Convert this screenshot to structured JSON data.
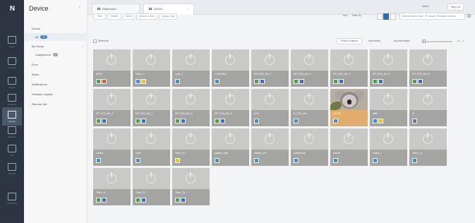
{
  "rail": {
    "logo": "N",
    "items": [
      {
        "name": "home",
        "label": "Home"
      },
      {
        "name": "content",
        "label": "Content"
      },
      {
        "name": "playlist",
        "label": "Playlist"
      },
      {
        "name": "schedule",
        "label": "Schedule"
      },
      {
        "name": "device",
        "label": "Device"
      },
      {
        "name": "statistics",
        "label": "Statistics"
      },
      {
        "name": "user",
        "label": "User"
      },
      {
        "name": "settings",
        "label": "Settings"
      },
      {
        "name": "information",
        "label": "Information"
      }
    ]
  },
  "nav": {
    "title": "Device",
    "items": [
      {
        "label": "Device",
        "badge": ""
      },
      {
        "label": "All",
        "badge": "33"
      },
      {
        "label": "By Group",
        "badge": ""
      },
      {
        "label": "Unapproved",
        "badge": "0"
      },
      {
        "label": "Error",
        "badge": ""
      },
      {
        "label": "Alarm",
        "badge": ""
      },
      {
        "label": "Notifications",
        "badge": ""
      },
      {
        "label": "Software Update",
        "badge": ""
      },
      {
        "label": "Remote Job",
        "badge": ""
      }
    ]
  },
  "tabs": [
    {
      "label": "Dashboard"
    },
    {
      "label": "Device"
    }
  ],
  "header": {
    "user": "admin",
    "signout": "Sign out"
  },
  "toolbar": {
    "buttons": [
      "Edit",
      "Delete",
      "Move",
      "Quick Control",
      "Assign Tag"
    ],
    "edit_label": "Edit",
    "delete_label": "Delete",
    "move_label": "Move",
    "quick_label": "Quick Control",
    "tag_label": "Assign Tag",
    "sort_label": "Sort",
    "sort_value": "Filter by",
    "search_placeholder": "Device Name, MAC, IP, Model, Firmware version"
  },
  "selbar": {
    "select_all": "Select All",
    "screen_capture": "Screen Capture",
    "information": "Information",
    "tag_information": "Tag Information",
    "size_range": "S — L"
  },
  "tiles": [
    {
      "name": "SSSP",
      "s1": "g",
      "s2": "red"
    },
    {
      "name": "Tizen_1",
      "s1": "b",
      "s2": "yel"
    },
    {
      "name": "Lynk_1",
      "s1": "b",
      "s2": ""
    },
    {
      "name": "LYNK3000",
      "s1": "b",
      "s2": ""
    },
    {
      "name": "DP_SSS_M4_1",
      "s1": "g",
      "s2": "blu"
    },
    {
      "name": "DP_SSS_M4_2",
      "s1": "g",
      "s2": "blu"
    },
    {
      "name": "DP_SSS_M4_3",
      "s1": "g",
      "s2": "blu"
    },
    {
      "name": "DP_SSS_M4_4",
      "s1": "g",
      "s2": "blu"
    },
    {
      "name": "DP_SSS_M4_5",
      "s1": "g",
      "s2": "blu"
    },
    {
      "name": "DP_SSS_M4_6",
      "s1": "g",
      "s2": "blu"
    },
    {
      "name": "DP_SSS_M4_7",
      "s1": "g",
      "s2": "blu"
    },
    {
      "name": "DP_SSS_M4_8",
      "s1": "g",
      "s2": "blu"
    },
    {
      "name": "DP_SSS_M4_9",
      "s1": "g",
      "s2": "blu"
    },
    {
      "name": "LFD",
      "s1": "b",
      "s2": ""
    },
    {
      "name": "S_SSS_M4",
      "s1": "b",
      "s2": ""
    },
    {
      "name": "UD-5R",
      "s1": "b",
      "s2": "",
      "selected": true
    },
    {
      "name": "IWB",
      "s1": "b",
      "s2": "yel"
    },
    {
      "name": "W",
      "s1": "b",
      "s2": "pur"
    },
    {
      "name": "Oldest",
      "s1": "b",
      "s2": ""
    },
    {
      "name": "Slide",
      "s1": "b",
      "s2": ""
    },
    {
      "name": "Tizen_10",
      "s1": "y",
      "s2": ""
    },
    {
      "name": "slotted_ApB",
      "s1": "b",
      "s2": ""
    },
    {
      "name": "slotted_4x4",
      "s1": "b",
      "s2": ""
    },
    {
      "name": "Dashboard",
      "s1": "b",
      "s2": ""
    },
    {
      "name": "Kernel",
      "s1": "b",
      "s2": ""
    },
    {
      "name": "Hotfix_1",
      "s1": "b",
      "s2": ""
    },
    {
      "name": "Tizen_14",
      "s1": "b",
      "s2": ""
    },
    {
      "name": "Tizen_11",
      "s1": "g",
      "s2": "blu"
    },
    {
      "name": "Tizen_12",
      "s1": "g",
      "s2": "blu"
    },
    {
      "name": "Tizen_13",
      "s1": "g",
      "s2": "blu"
    }
  ]
}
